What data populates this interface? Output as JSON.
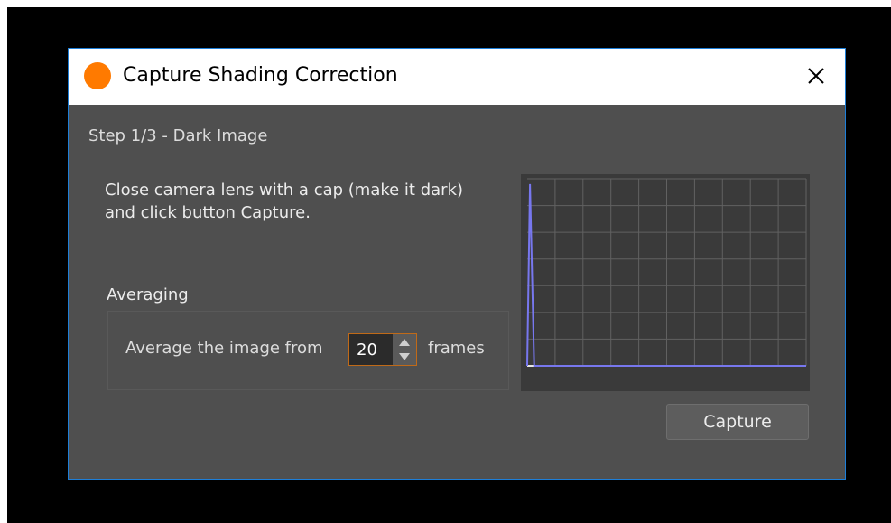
{
  "window": {
    "title": "Capture Shading Correction",
    "close_glyph": "✕"
  },
  "step": {
    "label": "Step 1/3  -  Dark Image"
  },
  "instructions": {
    "line1": "Close camera lens with a cap (make it dark)",
    "line2": "and click button Capture."
  },
  "averaging": {
    "group_title": "Averaging",
    "label": "Average the image from",
    "value": "20",
    "unit": "frames"
  },
  "capture_button": {
    "label": "Capture"
  },
  "icons": {
    "app": "app-logo-icon",
    "close": "close-icon",
    "spin_up": "chevron-up-icon",
    "spin_down": "chevron-down-icon"
  },
  "colors": {
    "app_icon": "#ff7a00",
    "window_border": "#1e7fd8",
    "dialog_bg": "#4f4f4f",
    "spinbox_border": "#c06a18",
    "histogram_line": "#7777ee"
  },
  "chart_data": {
    "type": "line",
    "grid": true,
    "legend": "none",
    "xlim": [
      0,
      10
    ],
    "ylim": [
      0,
      7
    ],
    "series": [
      {
        "x": [
          0,
          0.1,
          0.25,
          10
        ],
        "y": [
          0,
          6.8,
          0,
          0
        ]
      }
    ]
  }
}
